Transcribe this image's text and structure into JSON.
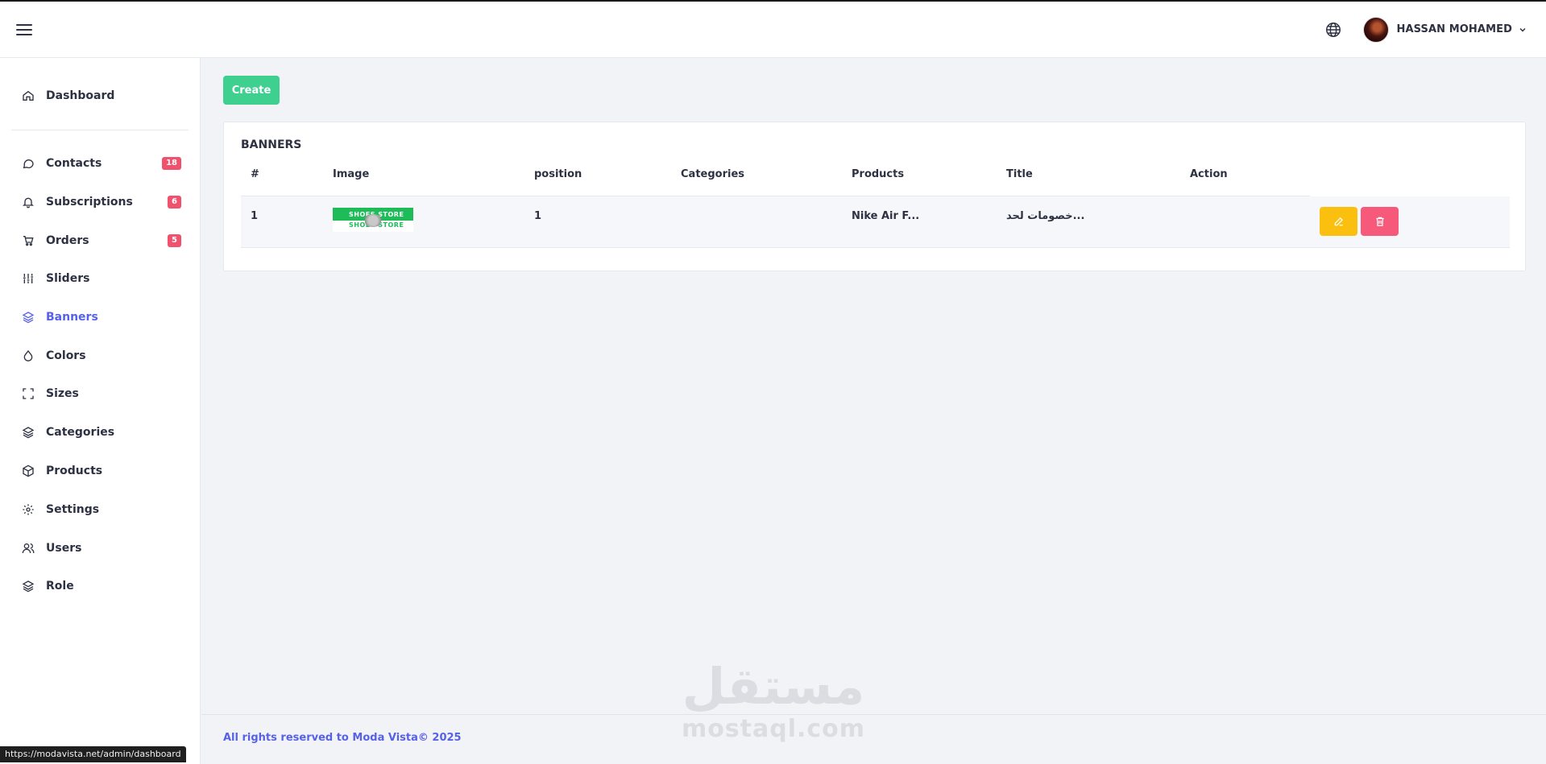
{
  "header": {
    "user_name": "HASSAN MOHAMED",
    "icons": [
      "hamburger-icon",
      "globe-icon",
      "chevron-down-icon"
    ]
  },
  "sidebar": {
    "items": [
      {
        "label": "Dashboard",
        "icon": "home-icon"
      },
      {
        "label": "Contacts",
        "icon": "chat-icon",
        "badge": "18"
      },
      {
        "label": "Subscriptions",
        "icon": "bell-icon",
        "badge": "6"
      },
      {
        "label": "Orders",
        "icon": "cart-icon",
        "badge": "5"
      },
      {
        "label": "Sliders",
        "icon": "sliders-icon"
      },
      {
        "label": "Banners",
        "icon": "layers-icon",
        "active": true
      },
      {
        "label": "Colors",
        "icon": "droplet-icon"
      },
      {
        "label": "Sizes",
        "icon": "maximize-icon"
      },
      {
        "label": "Categories",
        "icon": "layers-icon"
      },
      {
        "label": "Products",
        "icon": "box-icon"
      },
      {
        "label": "Settings",
        "icon": "gear-icon"
      },
      {
        "label": "Users",
        "icon": "users-icon"
      },
      {
        "label": "Role",
        "icon": "layers-icon"
      }
    ],
    "active_color": "#5661e8",
    "badge_color": "#f0516d"
  },
  "main": {
    "create_label": "Create",
    "card_title": "BANNERS",
    "table": {
      "columns": [
        "#",
        "Image",
        "position",
        "Categories",
        "Products",
        "Title",
        "Action"
      ],
      "rows": [
        {
          "id": "1",
          "image_text_top": "SHOES STORE",
          "image_text_bottom": "SHOES STORE",
          "position": "1",
          "categories": "",
          "products": "Nike Air F...",
          "title": "خصومات لحد..."
        }
      ]
    },
    "colors": {
      "create": "#3fcf8e",
      "edit": "#fbbf10",
      "delete": "#f6597a"
    }
  },
  "footer": {
    "text": "All rights reserved to Moda Vista© 2025"
  },
  "watermark": {
    "arabic": "مستقل",
    "latin": "mostaql.com"
  },
  "status_bar": {
    "url": "https://modavista.net/admin/dashboard"
  }
}
